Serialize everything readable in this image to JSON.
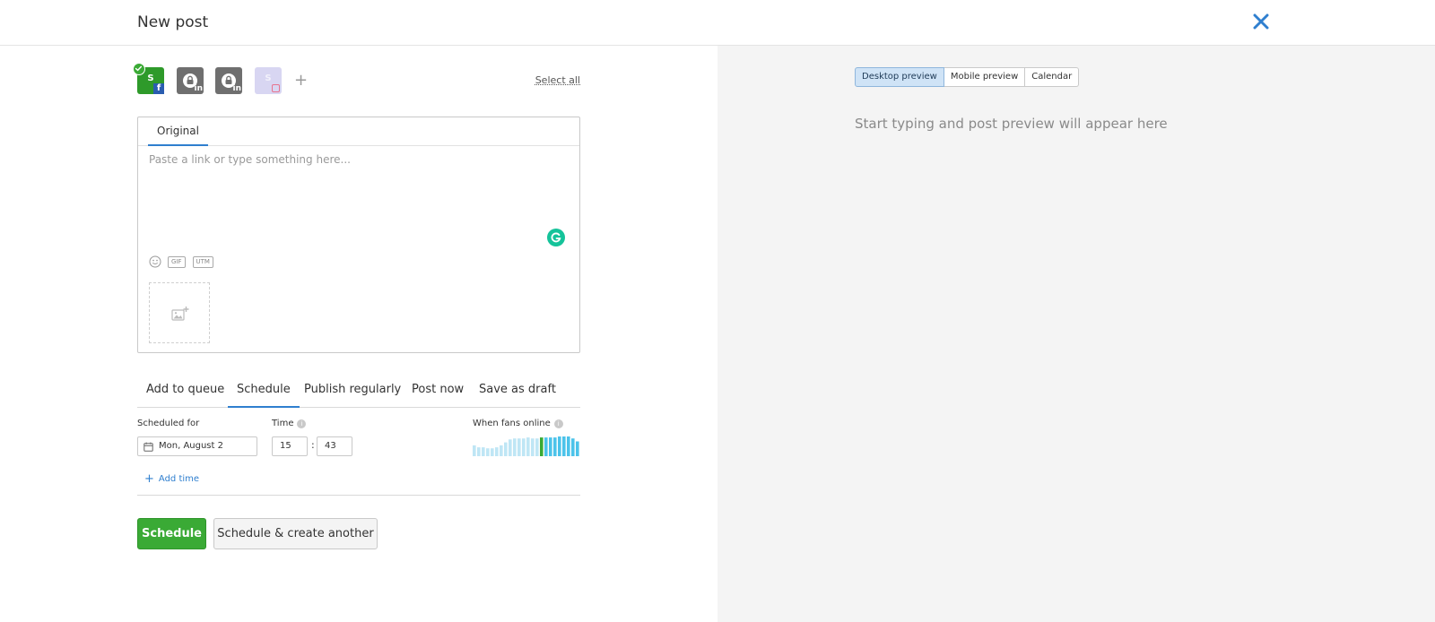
{
  "header": {
    "title": "New post"
  },
  "accounts": {
    "items": [
      {
        "letter": "S",
        "network": "facebook",
        "selected": true
      },
      {
        "letter": "",
        "network": "linkedin",
        "locked": true
      },
      {
        "letter": "",
        "network": "linkedin",
        "locked": true
      },
      {
        "letter": "S",
        "network": "instagram",
        "disabled": true
      }
    ],
    "fb_letter": "S",
    "fb_net": "f",
    "li_net": "in",
    "ig_letter": "S",
    "add_label": "+",
    "select_all": "Select all"
  },
  "editor": {
    "tab_original": "Original",
    "placeholder": "Paste a link or type something here...",
    "gif_label": "GIF",
    "utm_label": "UTM"
  },
  "mode_tabs": {
    "add_to_queue": "Add to queue",
    "schedule": "Schedule",
    "publish_regularly": "Publish regularly",
    "post_now": "Post now",
    "save_as_draft": "Save as draft",
    "active": "Schedule"
  },
  "schedule": {
    "scheduled_for_label": "Scheduled for",
    "date_value": "Mon, August 2",
    "time_label": "Time",
    "hour": "15",
    "minute": "43",
    "time_separator": ":",
    "fans_label": "When fans online",
    "fans_activity": [
      0.55,
      0.45,
      0.45,
      0.4,
      0.4,
      0.45,
      0.55,
      0.7,
      0.85,
      0.9,
      0.9,
      0.9,
      0.95,
      0.9,
      0.9,
      0.95,
      0.95,
      0.95,
      0.95,
      1.0,
      1.0,
      1.0,
      0.9,
      0.75
    ],
    "fans_current_index": 15,
    "add_time": "Add time"
  },
  "actions": {
    "primary": "Schedule",
    "secondary": "Schedule & create another"
  },
  "preview": {
    "tabs": [
      "Desktop preview",
      "Mobile preview",
      "Calendar"
    ],
    "active_tab": "Desktop preview",
    "hint": "Start typing and post preview will appear here"
  },
  "colors": {
    "accent_blue": "#2f7fcf",
    "primary_green": "#3aaa35",
    "chart_light": "#bfe6f5",
    "chart_strong": "#4cc3ea",
    "chart_current": "#3aaa35",
    "close_icon": "#2f7fcf"
  }
}
